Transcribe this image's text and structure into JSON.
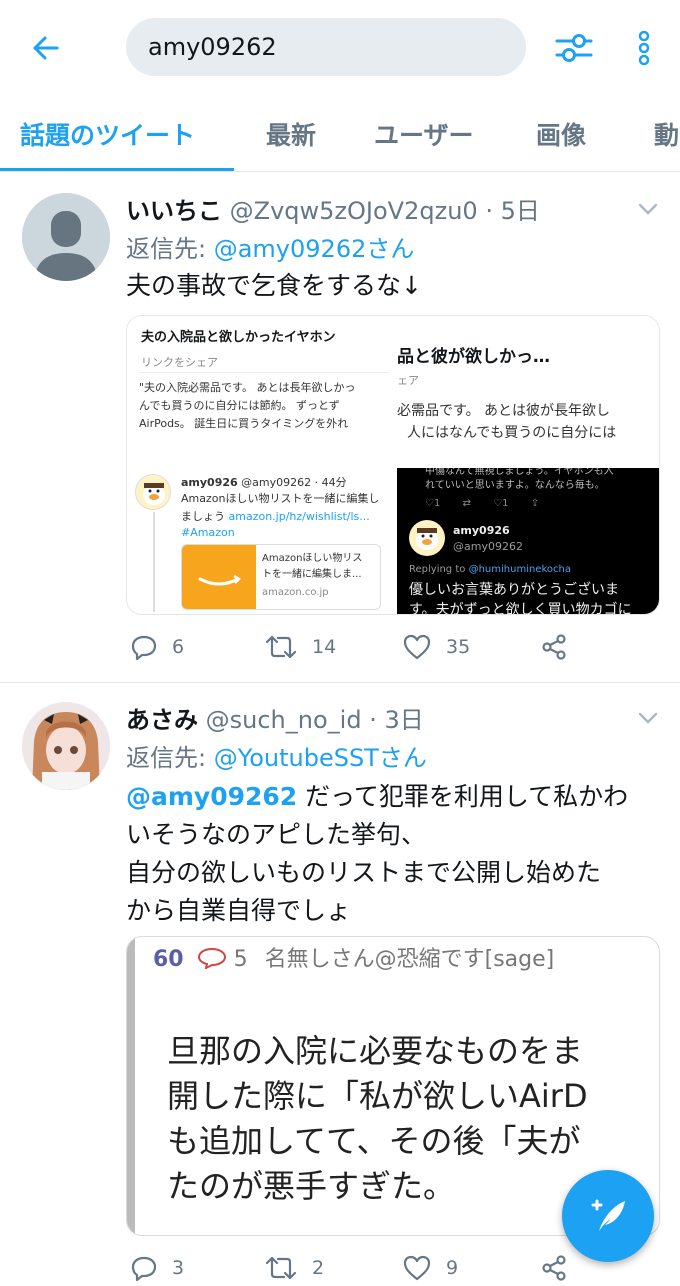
{
  "search": {
    "value": "amy09262"
  },
  "tabs": [
    {
      "label": "話題のツイート"
    },
    {
      "label": "最新"
    },
    {
      "label": "ユーザー"
    },
    {
      "label": "画像"
    },
    {
      "label": "動"
    }
  ],
  "tweets": [
    {
      "name": "いいちこ",
      "handle": "@Zvqw5zOJoV2qzu0",
      "time": "5日",
      "reply_prefix": "返信先: ",
      "reply_to": "@amy09262さん",
      "text": "夫の事故で乞食をするな↓",
      "replies": "6",
      "retweets": "14",
      "likes": "35",
      "media": {
        "card1_title": "夫の入院品と欲しかったイヤホン",
        "card1_sub": "リンクをシェア",
        "card1_line1": "\"夫の入院必需品です。 あとは長年欲しかっ",
        "card1_line2": "んでも買うのに自分には節約。 ずっとず",
        "card1_line3": "AirPods。 誕生日に買うタイミングを外れ",
        "card2_title": "品と彼が欲しかっ…",
        "card2_sub": "ェア",
        "card2_line1": "必需品です。 あとは彼が長年欲し",
        "card2_line2": "人にはなんでも買うのに自分には",
        "card3_name": "amy0926",
        "card3_handle": "@amy09262 · 44分",
        "card3_line1": "Amazonほしい物リストを一緒に編集し",
        "card3_line2": "ましょう",
        "card3_link": "amazon.jp/hz/wishlist/ls...",
        "card3_tag": "#Amazon",
        "card3_box1": "Amazonほしい物リス",
        "card3_box2": "トを一緒に編集しま...",
        "card3_box3": "amazon.co.jp",
        "card4_top1": "中傷なんて無視しましょう。イヤホンも入",
        "card4_top2": "れていいと思いますよ。なんなら毎も。",
        "card4_name": "amy0926",
        "card4_handle": "@amy09262",
        "card4_replying": "Replying to",
        "card4_replying_to": "@humihuminekocha",
        "card4_line1": "優しいお言葉ありがとうございま",
        "card4_line2": "す。夫がずっと欲しく買い物カゴに"
      }
    },
    {
      "name": "あさみ",
      "handle": "@such_no_id",
      "time": "3日",
      "reply_prefix": "返信先: ",
      "reply_to": "@YoutubeSSTさん",
      "mention": "@amy09262",
      "text_line1": " だって犯罪を利用して私かわ",
      "text_line2": "いそうなのアピした挙句、",
      "text_line3": "自分の欲しいものリストまで公開し始めた",
      "text_line4": "から自業自得でしょ",
      "replies": "3",
      "retweets": "2",
      "likes": "9",
      "embed": {
        "post_number": "60",
        "reply_count": "5",
        "poster": "名無しさん@恐縮です[sage]",
        "line1": "旦那の入院に必要なものをま",
        "line2": "開した際に「私が欲しいAirD",
        "line3": "も追加してて、その後「夫が",
        "line4": "たのが悪手すぎた。"
      }
    }
  ],
  "colors": {
    "accent": "#1da1f2",
    "secondary": "#657786"
  }
}
